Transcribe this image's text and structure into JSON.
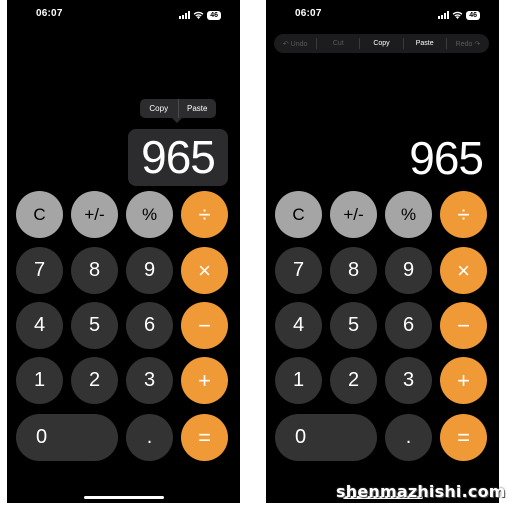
{
  "status_bar": {
    "time": "06:07",
    "battery": "46"
  },
  "left_screen": {
    "context_menu": {
      "copy": "Copy",
      "paste": "Paste"
    },
    "display_value": "965"
  },
  "right_screen": {
    "edit_bar": {
      "undo": "Undo",
      "cut": "Cut",
      "copy": "Copy",
      "paste": "Paste",
      "redo": "Redo"
    },
    "display_value": "965"
  },
  "keys": {
    "clear": "C",
    "sign": "+/-",
    "percent": "%",
    "divide": "÷",
    "seven": "7",
    "eight": "8",
    "nine": "9",
    "multiply": "×",
    "four": "4",
    "five": "5",
    "six": "6",
    "minus": "−",
    "one": "1",
    "two": "2",
    "three": "3",
    "plus": "+",
    "zero": "0",
    "decimal": ".",
    "equals": "="
  },
  "watermark": "shenmazhishi.com",
  "colors": {
    "function_key": "#a5a5a5",
    "digit_key": "#333333",
    "operator_key": "#f09a37",
    "background": "#000000"
  }
}
